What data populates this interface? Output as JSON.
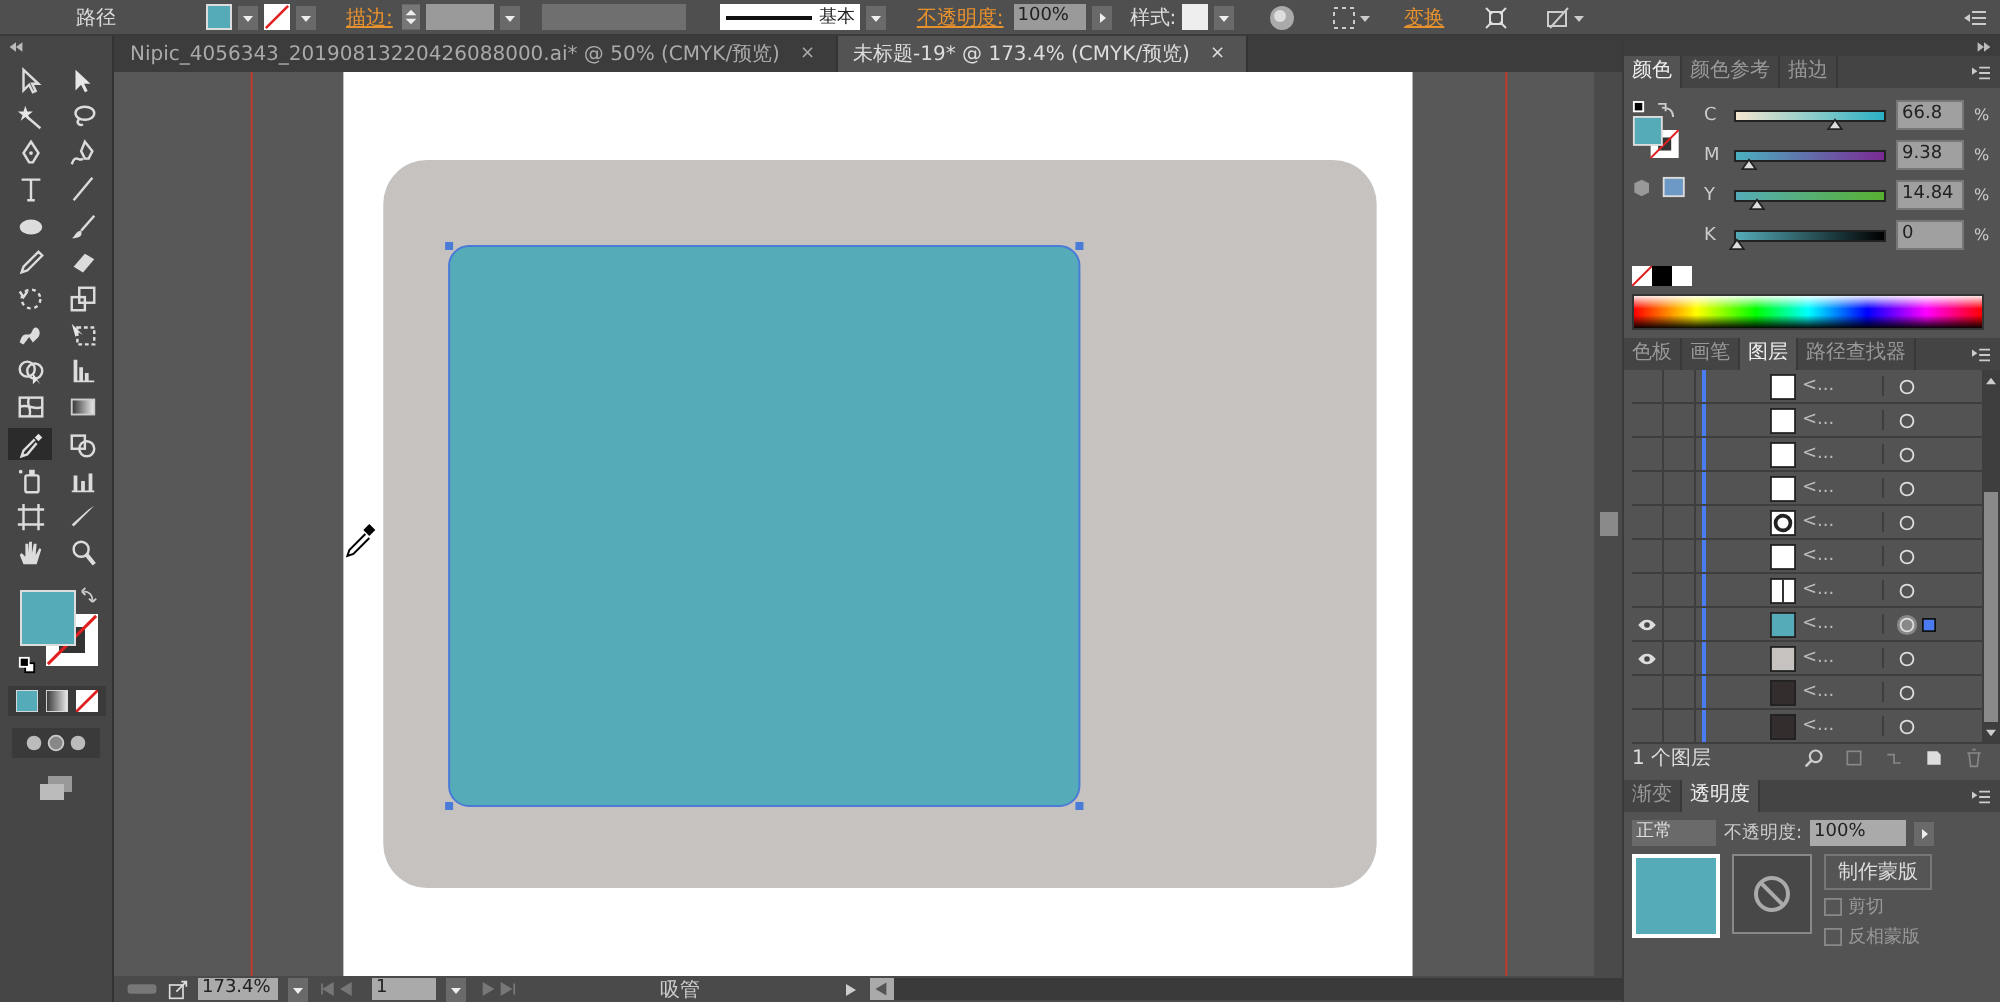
{
  "control_bar": {
    "selection_label": "路径",
    "stroke_label": "描边:",
    "brush_label": "基本",
    "opacity_label": "不透明度:",
    "opacity_value": "100%",
    "style_label": "样式:",
    "transform_link": "变换"
  },
  "document_tabs": [
    {
      "title": "Nipic_4056343_20190813220426088000.ai* @ 50% (CMYK/预览)",
      "close": "×",
      "selected": false
    },
    {
      "title": "未标题-19* @ 173.4% (CMYK/预览)",
      "close": "×",
      "selected": true
    }
  ],
  "tools": [
    {
      "kind": "selection",
      "selected": false
    },
    {
      "kind": "direct",
      "selected": false
    },
    {
      "kind": "wand",
      "selected": false
    },
    {
      "kind": "lasso",
      "selected": false
    },
    {
      "kind": "pen",
      "selected": false
    },
    {
      "kind": "curvature",
      "selected": false
    },
    {
      "kind": "type",
      "selected": false
    },
    {
      "kind": "line",
      "selected": false
    },
    {
      "kind": "ellipse",
      "selected": false
    },
    {
      "kind": "brush",
      "selected": false
    },
    {
      "kind": "pencil",
      "selected": false
    },
    {
      "kind": "eraser",
      "selected": false
    },
    {
      "kind": "rotate",
      "selected": false
    },
    {
      "kind": "scale",
      "selected": false
    },
    {
      "kind": "warp",
      "selected": false
    },
    {
      "kind": "freetransform",
      "selected": false
    },
    {
      "kind": "shapebuilder",
      "selected": false
    },
    {
      "kind": "perspective",
      "selected": false
    },
    {
      "kind": "mesh",
      "selected": false
    },
    {
      "kind": "gradient",
      "selected": false
    },
    {
      "kind": "eyedropper",
      "selected": true
    },
    {
      "kind": "blend",
      "selected": false
    },
    {
      "kind": "sprayer",
      "selected": false
    },
    {
      "kind": "graph",
      "selected": false
    },
    {
      "kind": "artboard",
      "selected": false
    },
    {
      "kind": "slice",
      "selected": false
    },
    {
      "kind": "hand",
      "selected": false
    },
    {
      "kind": "zoom",
      "selected": false
    }
  ],
  "color_panel": {
    "tabs": [
      {
        "label": "颜色",
        "selected": true
      },
      {
        "label": "颜色参考",
        "selected": false
      },
      {
        "label": "描边",
        "selected": false
      }
    ],
    "sliders": [
      {
        "letter": "C",
        "level": 0.668,
        "value": "66.8",
        "unit": "%"
      },
      {
        "letter": "M",
        "level": 0.094,
        "value": "9.38",
        "unit": "%"
      },
      {
        "letter": "Y",
        "level": 0.148,
        "value": "14.84",
        "unit": "%"
      },
      {
        "letter": "K",
        "level": 0,
        "value": "0",
        "unit": "%"
      }
    ]
  },
  "layers_panel": {
    "tabs": [
      {
        "label": "色板",
        "selected": false
      },
      {
        "label": "画笔",
        "selected": false
      },
      {
        "label": "图层",
        "selected": true
      },
      {
        "label": "路径查找器",
        "selected": false
      }
    ],
    "rows": [
      {
        "visible": false,
        "kind": "white",
        "label": "<...",
        "targeted": false
      },
      {
        "visible": false,
        "kind": "white",
        "label": "<...",
        "targeted": false
      },
      {
        "visible": false,
        "kind": "white",
        "label": "<...",
        "targeted": false
      },
      {
        "visible": false,
        "kind": "white",
        "label": "<...",
        "targeted": false
      },
      {
        "visible": false,
        "kind": "dot",
        "label": "<...",
        "targeted": false
      },
      {
        "visible": false,
        "kind": "white",
        "label": "<...",
        "targeted": false
      },
      {
        "visible": false,
        "kind": "split",
        "label": "<...",
        "targeted": false
      },
      {
        "visible": true,
        "kind": "cyan",
        "label": "<...",
        "targeted": true
      },
      {
        "visible": true,
        "kind": "gray",
        "label": "<...",
        "targeted": false
      },
      {
        "visible": false,
        "kind": "dark",
        "label": "<...",
        "targeted": false
      },
      {
        "visible": false,
        "kind": "dark",
        "label": "<...",
        "targeted": false
      }
    ],
    "footer": "1 个图层"
  },
  "transparency_panel": {
    "tabs": [
      {
        "label": "渐变",
        "selected": false
      },
      {
        "label": "透明度",
        "selected": true
      }
    ],
    "blend_mode": "正常",
    "opacity_label": "不透明度:",
    "opacity_value": "100%",
    "mask_button": "制作蒙版",
    "options": [
      {
        "label": "剪切",
        "checked": false
      },
      {
        "label": "反相蒙版",
        "checked": false
      }
    ]
  },
  "status_bar": {
    "zoom": "173.4%",
    "page": "1",
    "tool": "吸管"
  }
}
